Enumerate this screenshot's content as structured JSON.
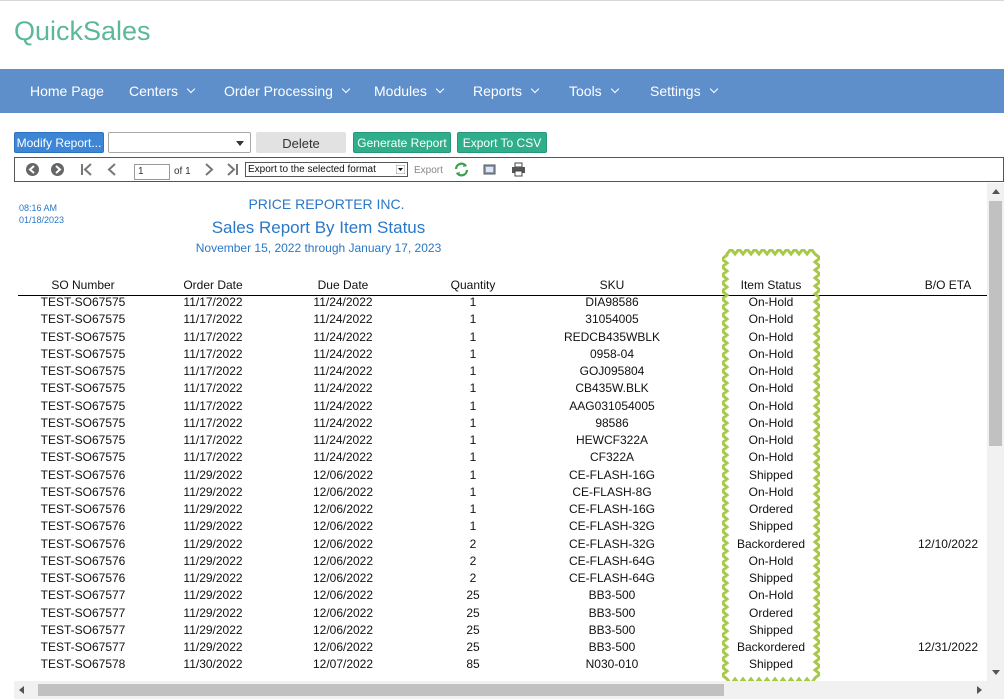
{
  "app": {
    "brand": "QuickSales"
  },
  "nav": [
    {
      "label": "Home Page",
      "dropdown": false
    },
    {
      "label": "Centers",
      "dropdown": true
    },
    {
      "label": "Order Processing",
      "dropdown": true
    },
    {
      "label": "Modules",
      "dropdown": true
    },
    {
      "label": "Reports",
      "dropdown": true
    },
    {
      "label": "Tools",
      "dropdown": true
    },
    {
      "label": "Settings",
      "dropdown": true
    }
  ],
  "toolbar": {
    "modify_label": "Modify Report...",
    "report_select_value": "",
    "delete_label": "Delete",
    "generate_label": "Generate Report",
    "export_csv_label": "Export To CSV"
  },
  "viewer": {
    "page_value": "1",
    "page_of": "of 1",
    "export_format": "Export to the selected format",
    "export_label": "Export"
  },
  "report": {
    "time": "08:16 AM",
    "date": "01/18/2023",
    "company": "PRICE REPORTER INC.",
    "title": "Sales Report By Item Status",
    "range": "November 15, 2022 through January 17, 2023",
    "columns": {
      "so": "SO Number",
      "order_date": "Order Date",
      "due_date": "Due Date",
      "qty": "Quantity",
      "sku": "SKU",
      "status": "Item Status",
      "eta": "B/O ETA"
    },
    "rows": [
      {
        "so": "TEST-SO67575",
        "od": "11/17/2022",
        "dd": "11/24/2022",
        "qty": "1",
        "sku": "DIA98586",
        "status": "On-Hold",
        "eta": ""
      },
      {
        "so": "TEST-SO67575",
        "od": "11/17/2022",
        "dd": "11/24/2022",
        "qty": "1",
        "sku": "31054005",
        "status": "On-Hold",
        "eta": ""
      },
      {
        "so": "TEST-SO67575",
        "od": "11/17/2022",
        "dd": "11/24/2022",
        "qty": "1",
        "sku": "REDCB435WBLK",
        "status": "On-Hold",
        "eta": ""
      },
      {
        "so": "TEST-SO67575",
        "od": "11/17/2022",
        "dd": "11/24/2022",
        "qty": "1",
        "sku": "0958-04",
        "status": "On-Hold",
        "eta": ""
      },
      {
        "so": "TEST-SO67575",
        "od": "11/17/2022",
        "dd": "11/24/2022",
        "qty": "1",
        "sku": "GOJ095804",
        "status": "On-Hold",
        "eta": ""
      },
      {
        "so": "TEST-SO67575",
        "od": "11/17/2022",
        "dd": "11/24/2022",
        "qty": "1",
        "sku": "CB435W.BLK",
        "status": "On-Hold",
        "eta": ""
      },
      {
        "so": "TEST-SO67575",
        "od": "11/17/2022",
        "dd": "11/24/2022",
        "qty": "1",
        "sku": "AAG031054005",
        "status": "On-Hold",
        "eta": ""
      },
      {
        "so": "TEST-SO67575",
        "od": "11/17/2022",
        "dd": "11/24/2022",
        "qty": "1",
        "sku": "98586",
        "status": "On-Hold",
        "eta": ""
      },
      {
        "so": "TEST-SO67575",
        "od": "11/17/2022",
        "dd": "11/24/2022",
        "qty": "1",
        "sku": "HEWCF322A",
        "status": "On-Hold",
        "eta": ""
      },
      {
        "so": "TEST-SO67575",
        "od": "11/17/2022",
        "dd": "11/24/2022",
        "qty": "1",
        "sku": "CF322A",
        "status": "On-Hold",
        "eta": ""
      },
      {
        "so": "TEST-SO67576",
        "od": "11/29/2022",
        "dd": "12/06/2022",
        "qty": "1",
        "sku": "CE-FLASH-16G",
        "status": "Shipped",
        "eta": ""
      },
      {
        "so": "TEST-SO67576",
        "od": "11/29/2022",
        "dd": "12/06/2022",
        "qty": "1",
        "sku": "CE-FLASH-8G",
        "status": "On-Hold",
        "eta": ""
      },
      {
        "so": "TEST-SO67576",
        "od": "11/29/2022",
        "dd": "12/06/2022",
        "qty": "1",
        "sku": "CE-FLASH-16G",
        "status": "Ordered",
        "eta": ""
      },
      {
        "so": "TEST-SO67576",
        "od": "11/29/2022",
        "dd": "12/06/2022",
        "qty": "1",
        "sku": "CE-FLASH-32G",
        "status": "Shipped",
        "eta": ""
      },
      {
        "so": "TEST-SO67576",
        "od": "11/29/2022",
        "dd": "12/06/2022",
        "qty": "2",
        "sku": "CE-FLASH-32G",
        "status": "Backordered",
        "eta": "12/10/2022"
      },
      {
        "so": "TEST-SO67576",
        "od": "11/29/2022",
        "dd": "12/06/2022",
        "qty": "2",
        "sku": "CE-FLASH-64G",
        "status": "On-Hold",
        "eta": ""
      },
      {
        "so": "TEST-SO67576",
        "od": "11/29/2022",
        "dd": "12/06/2022",
        "qty": "2",
        "sku": "CE-FLASH-64G",
        "status": "Shipped",
        "eta": ""
      },
      {
        "so": "TEST-SO67577",
        "od": "11/29/2022",
        "dd": "12/06/2022",
        "qty": "25",
        "sku": "BB3-500",
        "status": "On-Hold",
        "eta": ""
      },
      {
        "so": "TEST-SO67577",
        "od": "11/29/2022",
        "dd": "12/06/2022",
        "qty": "25",
        "sku": "BB3-500",
        "status": "Ordered",
        "eta": ""
      },
      {
        "so": "TEST-SO67577",
        "od": "11/29/2022",
        "dd": "12/06/2022",
        "qty": "25",
        "sku": "BB3-500",
        "status": "Shipped",
        "eta": ""
      },
      {
        "so": "TEST-SO67577",
        "od": "11/29/2022",
        "dd": "12/06/2022",
        "qty": "25",
        "sku": "BB3-500",
        "status": "Backordered",
        "eta": "12/31/2022"
      },
      {
        "so": "TEST-SO67578",
        "od": "11/30/2022",
        "dd": "12/07/2022",
        "qty": "85",
        "sku": "N030-010",
        "status": "Shipped",
        "eta": ""
      }
    ]
  },
  "colors": {
    "brand": "#5bb89a",
    "nav": "#5f8fcb",
    "report_text": "#2a78c7",
    "highlight": "#a8c84a"
  }
}
